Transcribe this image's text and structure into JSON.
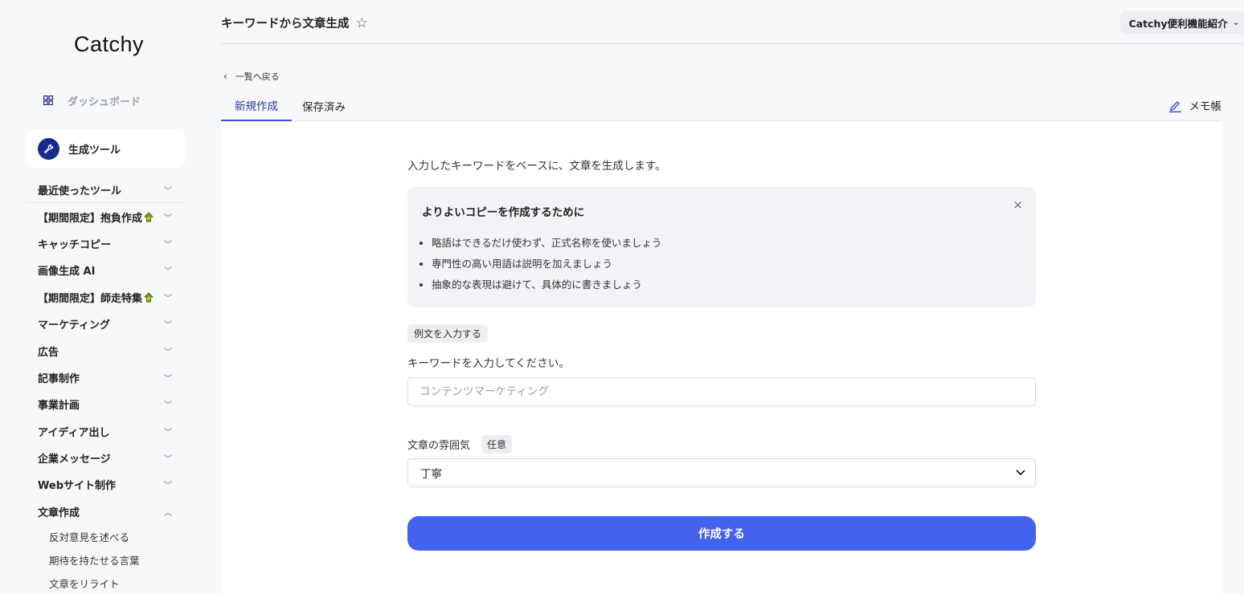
{
  "app": {
    "logo": "Catchy"
  },
  "sidebar": {
    "dashboard_label": "ダッシュボード",
    "gen_tools_label": "生成ツール",
    "menu": [
      {
        "label": "最近使ったツール",
        "chevron": "﹀",
        "badge": false
      },
      {
        "label": "【期間限定】抱負作成",
        "chevron": "﹀",
        "badge": true
      },
      {
        "label": "キャッチコピー",
        "chevron": "﹀",
        "badge": false
      },
      {
        "label": "画像生成 AI",
        "chevron": "﹀",
        "badge": false
      },
      {
        "label": "【期間限定】師走特集",
        "chevron": "﹀",
        "badge": true
      },
      {
        "label": "マーケティング",
        "chevron": "﹀",
        "badge": false
      },
      {
        "label": "広告",
        "chevron": "﹀",
        "badge": false
      },
      {
        "label": "記事制作",
        "chevron": "﹀",
        "badge": false
      },
      {
        "label": "事業計画",
        "chevron": "﹀",
        "badge": false
      },
      {
        "label": "アイディア出し",
        "chevron": "﹀",
        "badge": false
      },
      {
        "label": "企業メッセージ",
        "chevron": "﹀",
        "badge": false
      },
      {
        "label": "Webサイト制作",
        "chevron": "﹀",
        "badge": false
      },
      {
        "label": "文章作成",
        "chevron": "︿",
        "badge": false
      }
    ],
    "sub_items": [
      "反対意見を述べる",
      "期待を持たせる言葉",
      "文章をリライト"
    ]
  },
  "header": {
    "title": "キーワードから文章生成",
    "star_icon": "☆",
    "workspace": "Catchy便利機能紹介",
    "workspace_chevron": "⌄"
  },
  "nav": {
    "back_arrow": "‹",
    "back_label": "一覧へ戻る",
    "tabs": [
      "新規作成",
      "保存済み"
    ],
    "memo_label": "メモ帳"
  },
  "form": {
    "intro": "入力したキーワードをベースに、文章を生成します。",
    "tips": {
      "title": "よりよいコピーを作成するために",
      "close": "×",
      "items": [
        "略語はできるだけ使わず、正式名称を使いましょう",
        "専門性の高い用語は説明を加えましょう",
        "抽象的な表現は避けて、具体的に書きましょう"
      ]
    },
    "example_button": "例文を入力する",
    "keyword_label": "キーワードを入力してください。",
    "keyword_value": "",
    "keyword_placeholder": "コンテンツマーケティング",
    "mood_label": "文章の雰囲気",
    "mood_optional": "任意",
    "mood_value": "丁寧",
    "submit_label": "作成する"
  },
  "colors": {
    "accent": "#4562ef",
    "brand_dark": "#1a2a8c",
    "tab_active": "#2a3a9a"
  }
}
